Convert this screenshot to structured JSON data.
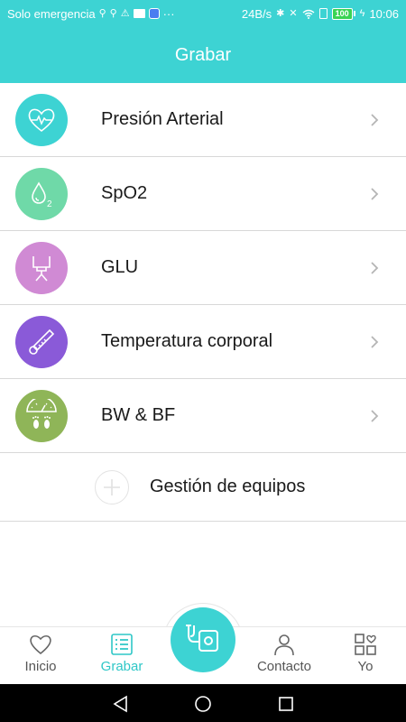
{
  "status_bar": {
    "carrier": "Solo emergencia",
    "extra": "···",
    "speed": "24B/s",
    "battery": "100",
    "time": "10:06"
  },
  "header": {
    "title": "Grabar"
  },
  "colors": {
    "accent": "#3dd3d3",
    "active_tab": "#2ec7c7",
    "blood_pressure": "#3dd3d3",
    "spo2": "#6fd9a8",
    "glucose": "#d08ad4",
    "temperature": "#8a5ad8",
    "weight": "#8fb558"
  },
  "menu": {
    "items": [
      {
        "label": "Presión Arterial",
        "icon": "heart-pulse-icon"
      },
      {
        "label": "SpO2",
        "icon": "drop-o2-icon"
      },
      {
        "label": "GLU",
        "icon": "glucose-meter-icon"
      },
      {
        "label": "Temperatura corporal",
        "icon": "thermometer-icon"
      },
      {
        "label": "BW & BF",
        "icon": "scale-footprints-icon"
      }
    ],
    "device_management": {
      "label": "Gestión de equipos",
      "icon": "plus-icon"
    }
  },
  "tabs": [
    {
      "label": "Inicio",
      "icon": "heart-icon",
      "active": false
    },
    {
      "label": "Grabar",
      "icon": "list-icon",
      "active": true
    },
    {
      "label": "Contacto",
      "icon": "person-icon",
      "active": false
    },
    {
      "label": "Yo",
      "icon": "grid-heart-icon",
      "active": false
    }
  ],
  "fab": {
    "icon": "measure-device-icon"
  }
}
